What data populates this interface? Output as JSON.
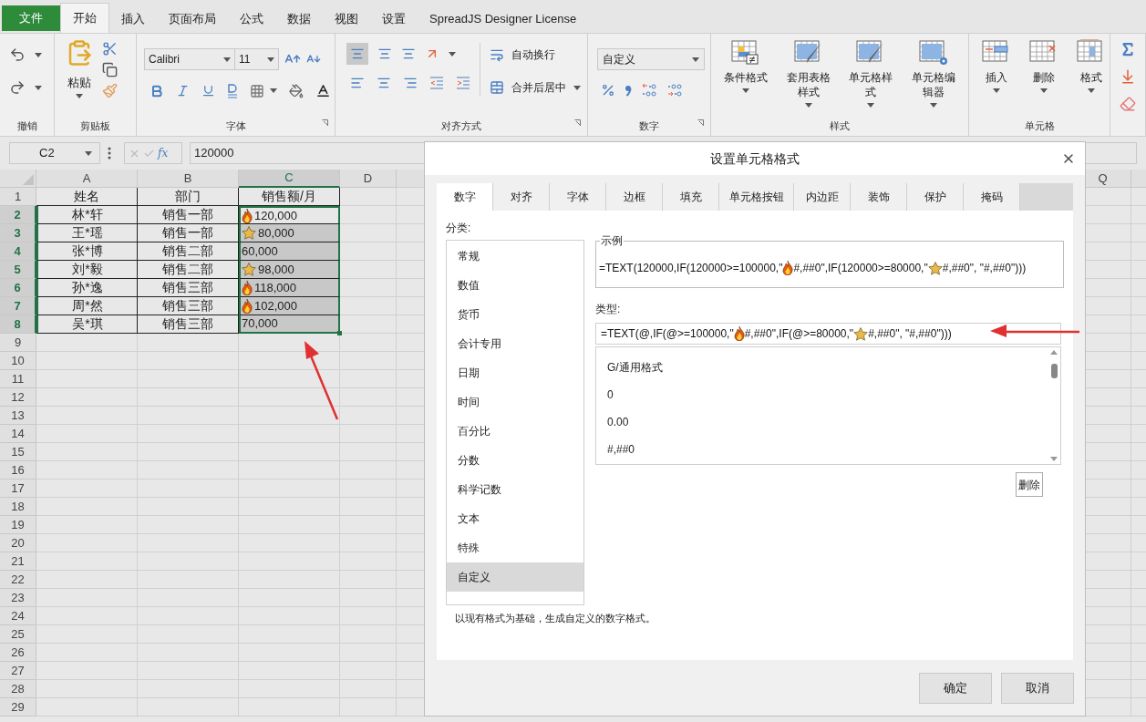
{
  "ribbon_tabs": [
    {
      "label": "文件",
      "kind": "file",
      "selected": false
    },
    {
      "label": "开始",
      "kind": "tab",
      "selected": true
    },
    {
      "label": "插入",
      "kind": "tab",
      "selected": false
    },
    {
      "label": "页面布局",
      "kind": "tab",
      "selected": false
    },
    {
      "label": "公式",
      "kind": "tab",
      "selected": false
    },
    {
      "label": "数据",
      "kind": "tab",
      "selected": false
    },
    {
      "label": "视图",
      "kind": "tab",
      "selected": false
    },
    {
      "label": "设置",
      "kind": "tab",
      "selected": false
    },
    {
      "label": "SpreadJS Designer License",
      "kind": "tab",
      "selected": false
    }
  ],
  "ribbon": {
    "groups": [
      {
        "kind": "undo",
        "label": "撤销"
      },
      {
        "kind": "clipboard",
        "label": "剪贴板",
        "paste": "粘贴"
      },
      {
        "kind": "font",
        "label": "字体",
        "font": "Calibri",
        "size": "11"
      },
      {
        "kind": "align",
        "label": "对齐方式",
        "wrap": "自动换行",
        "merge": "合并后居中"
      },
      {
        "kind": "number",
        "label": "数字",
        "format": "自定义"
      },
      {
        "kind": "styles",
        "label": "样式",
        "buttons": [
          "条件格式",
          "套用表格样式",
          "单元格样式",
          "单元格编辑器"
        ]
      },
      {
        "kind": "cells",
        "label": "单元格",
        "buttons": [
          "插入",
          "删除",
          "格式"
        ]
      },
      {
        "kind": "editing"
      }
    ]
  },
  "formula_bar": {
    "name_box": "C2",
    "fx": "fx",
    "value": "120000"
  },
  "grid": {
    "columns": [
      {
        "label": "A",
        "selected": false
      },
      {
        "label": "B",
        "selected": false
      },
      {
        "label": "C",
        "selected": true
      },
      {
        "label": "D",
        "selected": false
      },
      {
        "label": "Q",
        "selected": false
      }
    ],
    "rows": [
      {
        "label": "1",
        "selected": false,
        "cells": [
          {
            "text": "姓名"
          },
          {
            "text": "部门"
          },
          {
            "text": "销售额/月",
            "kind": "header"
          }
        ]
      },
      {
        "label": "2",
        "selected": true,
        "cells": [
          {
            "text": "林*轩"
          },
          {
            "text": "销售一部"
          },
          {
            "text": "120,000",
            "kind": "fire",
            "active": true
          }
        ]
      },
      {
        "label": "3",
        "selected": true,
        "cells": [
          {
            "text": "王*瑶"
          },
          {
            "text": "销售一部"
          },
          {
            "text": "80,000",
            "kind": "star",
            "active": false
          }
        ]
      },
      {
        "label": "4",
        "selected": true,
        "cells": [
          {
            "text": "张*博"
          },
          {
            "text": "销售二部"
          },
          {
            "text": "60,000",
            "kind": "plain",
            "active": false
          }
        ]
      },
      {
        "label": "5",
        "selected": true,
        "cells": [
          {
            "text": "刘*毅"
          },
          {
            "text": "销售二部"
          },
          {
            "text": "98,000",
            "kind": "star",
            "active": false
          }
        ]
      },
      {
        "label": "6",
        "selected": true,
        "cells": [
          {
            "text": "孙*逸"
          },
          {
            "text": "销售三部"
          },
          {
            "text": "118,000",
            "kind": "fire",
            "active": false
          }
        ]
      },
      {
        "label": "7",
        "selected": true,
        "cells": [
          {
            "text": "周*然"
          },
          {
            "text": "销售三部"
          },
          {
            "text": "102,000",
            "kind": "fire",
            "active": false
          }
        ]
      },
      {
        "label": "8",
        "selected": true,
        "cells": [
          {
            "text": "吴*琪"
          },
          {
            "text": "销售三部"
          },
          {
            "text": "70,000",
            "kind": "plain",
            "active": false
          }
        ]
      },
      {
        "label": "9",
        "selected": false
      },
      {
        "label": "10",
        "selected": false
      },
      {
        "label": "11",
        "selected": false
      },
      {
        "label": "12",
        "selected": false
      },
      {
        "label": "13",
        "selected": false
      },
      {
        "label": "14",
        "selected": false
      },
      {
        "label": "15",
        "selected": false
      },
      {
        "label": "16",
        "selected": false
      },
      {
        "label": "17",
        "selected": false
      },
      {
        "label": "18",
        "selected": false
      },
      {
        "label": "19",
        "selected": false
      },
      {
        "label": "20",
        "selected": false
      },
      {
        "label": "21",
        "selected": false
      },
      {
        "label": "22",
        "selected": false
      },
      {
        "label": "23",
        "selected": false
      },
      {
        "label": "24",
        "selected": false
      },
      {
        "label": "25",
        "selected": false
      },
      {
        "label": "26",
        "selected": false
      },
      {
        "label": "27",
        "selected": false
      },
      {
        "label": "28",
        "selected": false
      },
      {
        "label": "29",
        "selected": false
      }
    ]
  },
  "dialog": {
    "title": "设置单元格格式",
    "tabs": [
      {
        "label": "数字",
        "selected": true
      },
      {
        "label": "对齐",
        "selected": false
      },
      {
        "label": "字体",
        "selected": false
      },
      {
        "label": "边框",
        "selected": false
      },
      {
        "label": "填充",
        "selected": false
      },
      {
        "label": "单元格按钮",
        "selected": false
      },
      {
        "label": "内边距",
        "selected": false
      },
      {
        "label": "装饰",
        "selected": false
      },
      {
        "label": "保护",
        "selected": false
      },
      {
        "label": "掩码",
        "selected": false
      }
    ],
    "category_label": "分类:",
    "categories": [
      {
        "label": "常规",
        "selected": false
      },
      {
        "label": "数值",
        "selected": false
      },
      {
        "label": "货币",
        "selected": false
      },
      {
        "label": "会计专用",
        "selected": false
      },
      {
        "label": "日期",
        "selected": false
      },
      {
        "label": "时间",
        "selected": false
      },
      {
        "label": "百分比",
        "selected": false
      },
      {
        "label": "分数",
        "selected": false
      },
      {
        "label": "科学记数",
        "selected": false
      },
      {
        "label": "文本",
        "selected": false
      },
      {
        "label": "特殊",
        "selected": false
      },
      {
        "label": "自定义",
        "selected": true
      }
    ],
    "sample_label": "示例",
    "sample": [
      {
        "kind": "text",
        "text": "=TEXT(120000,IF(120000>=100000,\""
      },
      {
        "kind": "fire"
      },
      {
        "kind": "text",
        "text": "#,##0\",IF(120000>=80000,\""
      },
      {
        "kind": "star"
      },
      {
        "kind": "text",
        "text": "#,##0\", \"#,##0\")))"
      }
    ],
    "type_label": "类型:",
    "type": [
      {
        "kind": "text",
        "text": "=TEXT(@,IF(@>=100000,\""
      },
      {
        "kind": "fire"
      },
      {
        "kind": "text",
        "text": "#,##0\",IF(@>=80000,\""
      },
      {
        "kind": "star"
      },
      {
        "kind": "text",
        "text": "#,##0\", \"#,##0\")))"
      }
    ],
    "formats": [
      "G/通用格式",
      "0",
      "0.00",
      "#,##0"
    ],
    "delete_button": "删除",
    "description": "以现有格式为基础，生成自定义的数字格式。",
    "buttons": [
      "确定",
      "取消"
    ]
  }
}
